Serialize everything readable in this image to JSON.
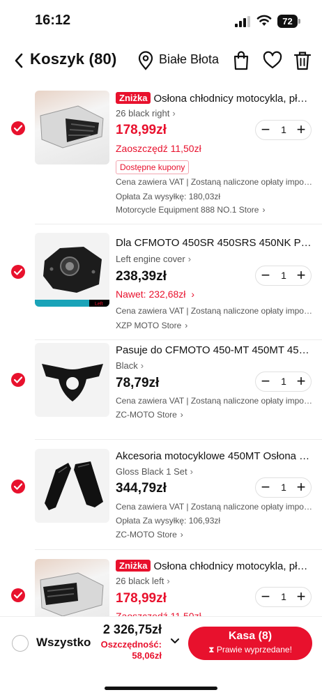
{
  "status_bar": {
    "time": "16:12",
    "battery": "72"
  },
  "header": {
    "title": "Koszyk (80)",
    "location": "Białe Błota"
  },
  "items": [
    {
      "badge": "Zniżka",
      "title": "Osłona chłodnicy motocykla, płyt...",
      "variant": "26 black right",
      "price": "178,99zł",
      "savings": "Zaoszczędź 11,50zł",
      "coupon": "Dostępne kupony",
      "vat": "Cena zawiera VAT | Zostaną naliczone opłaty impor...",
      "shipping": "Opłata Za wysyłkę: 180,03zł",
      "store": "Motorcycle Equipment 888 NO.1 Store",
      "qty": "1"
    },
    {
      "badge": "",
      "title": "Dla CFMOTO 450SR 450SRS 450NK Pok...",
      "variant": "Left engine cover",
      "price": "238,39zł",
      "savings": "Nawet: 232,68zł",
      "coupon": "",
      "vat": "Cena zawiera VAT | Zostaną naliczone opłaty impor...",
      "shipping": "",
      "store": "XZP MOTO Store",
      "qty": "1",
      "thumb_tag": "Left"
    },
    {
      "badge": "",
      "title": "Pasuje do CFMOTO 450-MT 450MT 450...",
      "variant": "Black",
      "price": "78,79zł",
      "savings": "",
      "coupon": "",
      "vat": "Cena zawiera VAT | Zostaną naliczone opłaty impor...",
      "shipping": "",
      "store": "ZC-MOTO Store",
      "qty": "1"
    },
    {
      "badge": "",
      "title": "Akcesoria motocyklowe 450MT Osłona bo...",
      "variant": "Gloss Black 1 Set",
      "price": "344,79zł",
      "savings": "",
      "coupon": "",
      "vat": "Cena zawiera VAT | Zostaną naliczone opłaty impor...",
      "shipping": "Opłata Za wysyłkę: 106,93zł",
      "store": "ZC-MOTO Store",
      "qty": "1"
    },
    {
      "badge": "Zniżka",
      "title": "Osłona chłodnicy motocykla, płyt...",
      "variant": "26 black left",
      "price": "178,99zł",
      "savings": "Zaoszczędź 11,50zł",
      "coupon": "",
      "vat": "",
      "shipping": "",
      "store": "",
      "qty": "1"
    }
  ],
  "footer": {
    "select_all": "Wszystko",
    "total": "2 326,75zł",
    "savings_label": "Oszczędność:",
    "savings_value": "58,06zł",
    "checkout_label": "Kasa (8)",
    "checkout_sub": "Prawie wyprzedane!"
  },
  "colors": {
    "accent": "#e8112d"
  }
}
